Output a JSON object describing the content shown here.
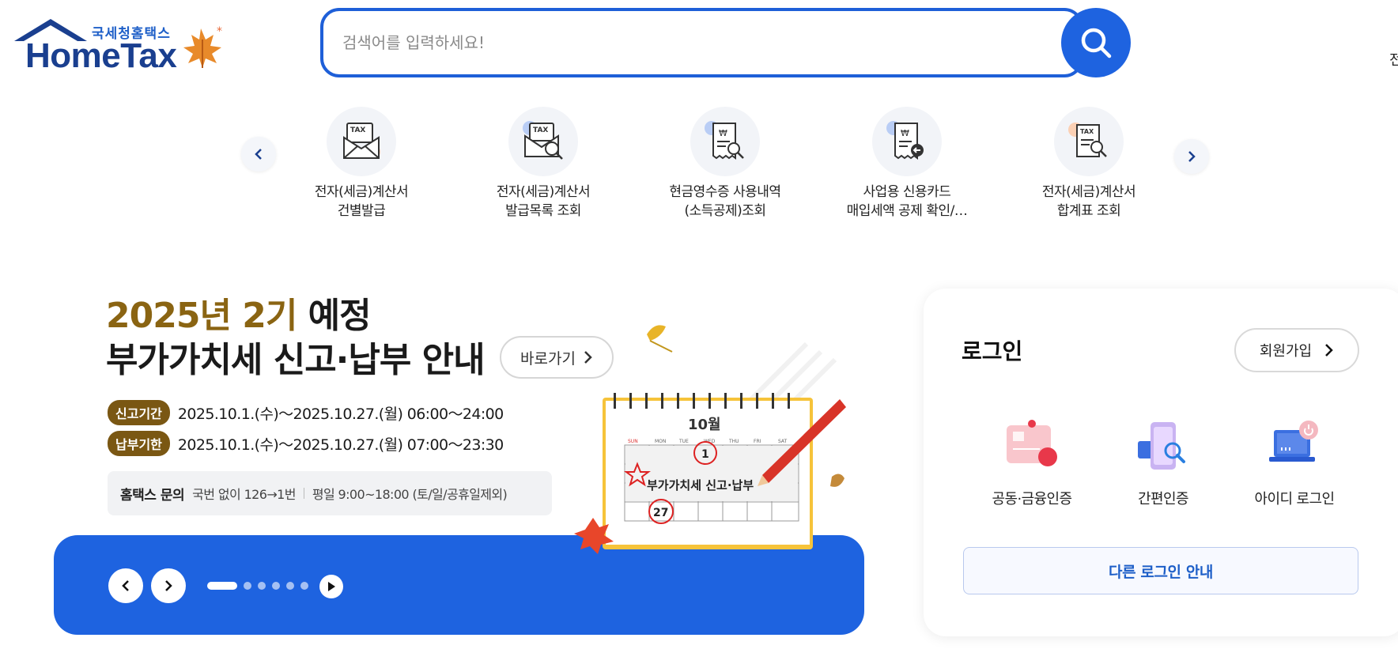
{
  "header": {
    "logo_sub": "국세청홈택스",
    "logo_main": "HomeTax",
    "search_placeholder": "검색어를 입력하세요!",
    "edge_char": "전"
  },
  "quick_menu": [
    {
      "line1": "전자(세금)계산서",
      "line2": "건별발급",
      "icon": "tax-envelope-icon"
    },
    {
      "line1": "전자(세금)계산서",
      "line2": "발급목록 조회",
      "icon": "tax-search-icon"
    },
    {
      "line1": "현금영수증 사용내역",
      "line2": "(소득공제)조회",
      "icon": "receipt-search-icon"
    },
    {
      "line1": "사업용 신용카드",
      "line2": "매입세액 공제 확인/…",
      "icon": "receipt-return-icon"
    },
    {
      "line1": "전자(세금)계산서",
      "line2": "합계표 조회",
      "icon": "tax-doc-search-icon"
    }
  ],
  "banner": {
    "title_brown": "2025년 2기",
    "title_dark1": " 예정",
    "title_line2": "부가가치세 신고·납부 안내",
    "go_label": "바로가기",
    "rows": [
      {
        "pill": "신고기간",
        "text": "2025.10.1.(수)～2025.10.27.(월) 06:00～24:00"
      },
      {
        "pill": "납부기한",
        "text": "2025.10.1.(수)～2025.10.27.(월) 07:00～23:30"
      }
    ],
    "contact_head": "홈택스 문의",
    "contact_text1": "국번 없이 126→1번",
    "contact_text2": "평일 9:00~18:00 (토/일/공휴일제외)",
    "calendar_month": "10월",
    "calendar_days": [
      "SUN",
      "MON",
      "TUE",
      "WED",
      "THU",
      "FRI",
      "SAT"
    ],
    "calendar_day1": "1",
    "calendar_day27": "27",
    "calendar_event": "부가가치세 신고·납부",
    "slide_count": 6,
    "active_slide": 1
  },
  "login": {
    "title": "로그인",
    "join_label": "회원가입",
    "options": [
      {
        "label": "공동·금융인증",
        "icon": "certificate-card-icon"
      },
      {
        "label": "간편인증",
        "icon": "simple-auth-icon"
      },
      {
        "label": "아이디 로그인",
        "icon": "id-login-laptop-icon"
      }
    ],
    "other_login": "다른 로그인 안내"
  },
  "colors": {
    "brand_blue": "#1e63e0",
    "brown": "#8a6412",
    "logo_navy": "#1a3f8f"
  }
}
